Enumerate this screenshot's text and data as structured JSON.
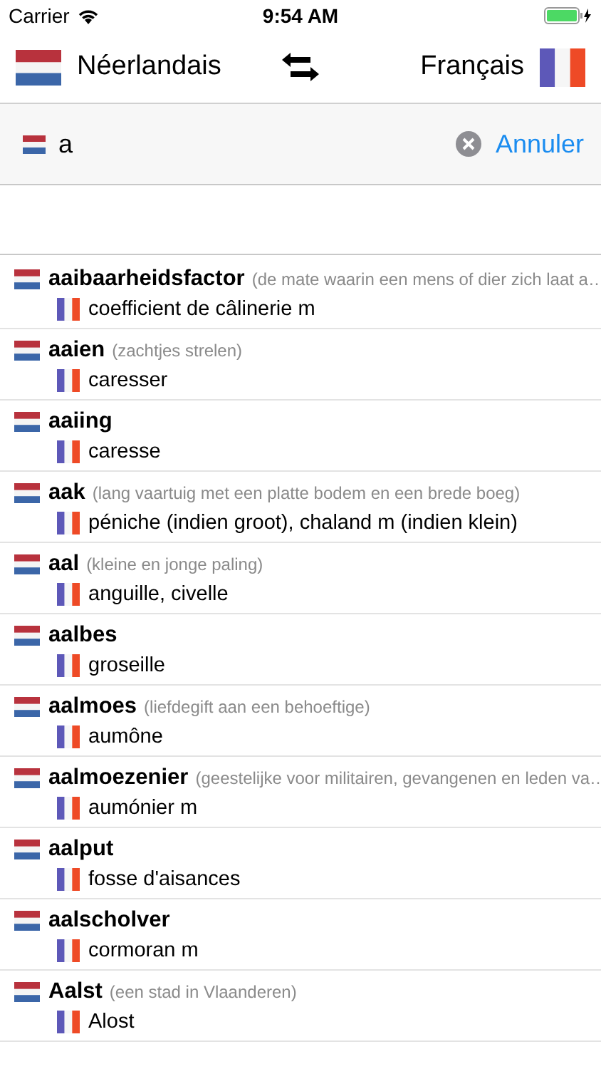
{
  "status_bar": {
    "carrier": "Carrier",
    "time": "9:54 AM"
  },
  "languages": {
    "source": "Néerlandais",
    "target": "Français"
  },
  "search": {
    "value": "a",
    "cancel": "Annuler"
  },
  "results": [
    {
      "word": "aaibaarheidsfactor",
      "gloss": "(de mate waarin een mens of dier zich laat a…",
      "translation": "coefficient de câlinerie m"
    },
    {
      "word": "aaien",
      "gloss": "(zachtjes strelen)",
      "translation": "caresser"
    },
    {
      "word": "aaiing",
      "translation": "caresse"
    },
    {
      "word": "aak",
      "gloss": "(lang vaartuig met een platte bodem en een brede boeg)",
      "translation": "péniche (indien groot), chaland m (indien klein)"
    },
    {
      "word": "aal",
      "gloss": "(kleine en jonge paling)",
      "translation": "anguille, civelle"
    },
    {
      "word": "aalbes",
      "translation": "groseille"
    },
    {
      "word": "aalmoes",
      "gloss": "(liefdegift aan een behoeftige)",
      "translation": "aumône"
    },
    {
      "word": "aalmoezenier",
      "gloss": "(geestelijke voor militairen, gevangenen en leden va…",
      "translation": "aumónier m"
    },
    {
      "word": "aalput",
      "translation": "fosse d'aisances"
    },
    {
      "word": "aalscholver",
      "translation": "cormoran m"
    },
    {
      "word": "Aalst",
      "gloss": "(een stad in Vlaanderen)",
      "translation": "Alost"
    }
  ]
}
